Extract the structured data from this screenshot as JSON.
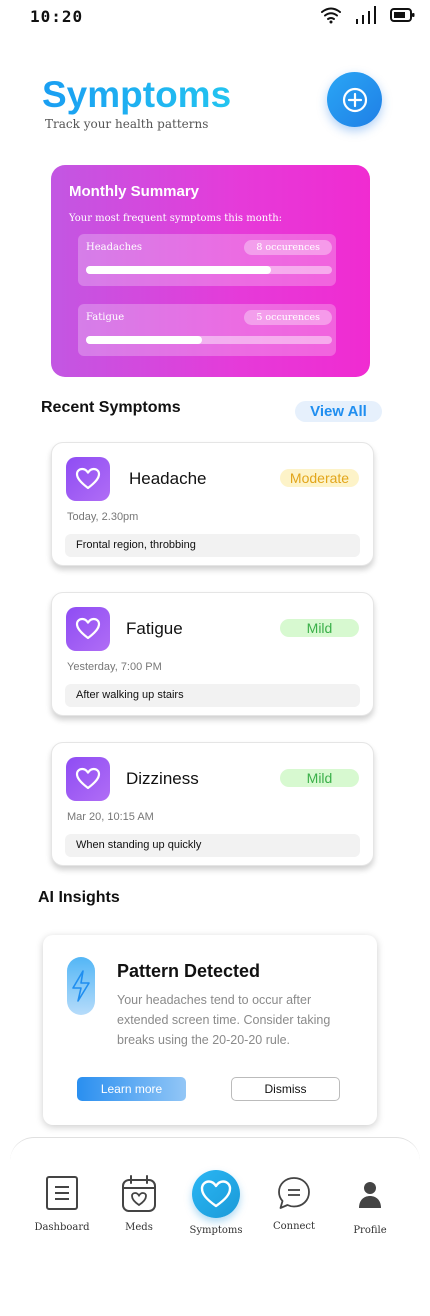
{
  "status_bar": {
    "time": "10:20"
  },
  "header": {
    "title": "Symptoms",
    "subtitle": "Track your health patterns"
  },
  "summary": {
    "title": "Monthly Summary",
    "description": "Your most frequent symptoms this month:",
    "items": [
      {
        "name": "Headaches",
        "count": "8 occurences",
        "level": 0.75
      },
      {
        "name": "Fatigue",
        "count": "5 occurences",
        "level": 0.47
      }
    ]
  },
  "recent": {
    "title": "Recent Symptoms",
    "view_all": "View All",
    "items": [
      {
        "name": "Headache",
        "severity": "Moderate",
        "time": "Today, 2.30pm",
        "note": "Frontal region, throbbing"
      },
      {
        "name": "Fatigue",
        "severity": "Mild",
        "time": "Yesterday, 7:00 PM",
        "note": "After walking up stairs"
      },
      {
        "name": "Dizziness",
        "severity": "Mild",
        "time": "Mar 20, 10:15 AM",
        "note": "When standing up quickly"
      }
    ]
  },
  "insights": {
    "title": "AI Insights",
    "card": {
      "title": "Pattern Detected",
      "text": "Your headaches tend to occur after extended screen time. Consider taking breaks using the 20-20-20 rule.",
      "learn_more": "Learn more",
      "dismiss": "Dismiss"
    }
  },
  "nav": {
    "items": [
      {
        "label": "Dashboard"
      },
      {
        "label": "Meds"
      },
      {
        "label": "Symptoms"
      },
      {
        "label": "Connect"
      },
      {
        "label": "Profile"
      }
    ],
    "active": "Symptoms"
  },
  "colors": {
    "accent": "#1a9ef2",
    "summary_start": "#c257e2",
    "summary_end": "#f02bd1",
    "moderate": "#e2a51a",
    "mild": "#3bb04a"
  }
}
